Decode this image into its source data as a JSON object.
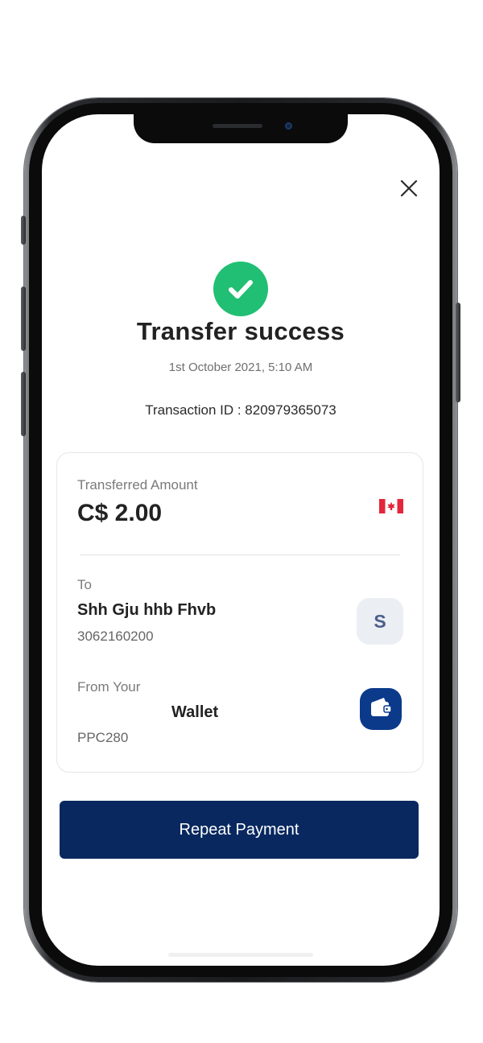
{
  "header": {
    "close_icon": "close-icon"
  },
  "status": {
    "icon": "check-circle-icon",
    "color": "#21BF73",
    "title": "Transfer success",
    "datetime": "1st October  2021, 5:10 AM",
    "transaction_id_text": "Transaction ID : 820979365073"
  },
  "details": {
    "amount_label": "Transferred Amount",
    "amount": "C$ 2.00",
    "currency_flag_icon": "canada-flag-icon",
    "to_label": "To",
    "recipient_name": "Shh Gju hhb Fhvb",
    "recipient_account": "3062160200",
    "recipient_avatar_initial": "S",
    "from_label": "From Your",
    "wallet_name": "Wallet",
    "wallet_code": "PPC280",
    "wallet_icon": "wallet-icon"
  },
  "actions": {
    "repeat_label": "Repeat Payment"
  },
  "colors": {
    "primary": "#08285F",
    "wallet_badge": "#0B3A8A",
    "success": "#21BF73",
    "flag_red": "#E3263B"
  }
}
